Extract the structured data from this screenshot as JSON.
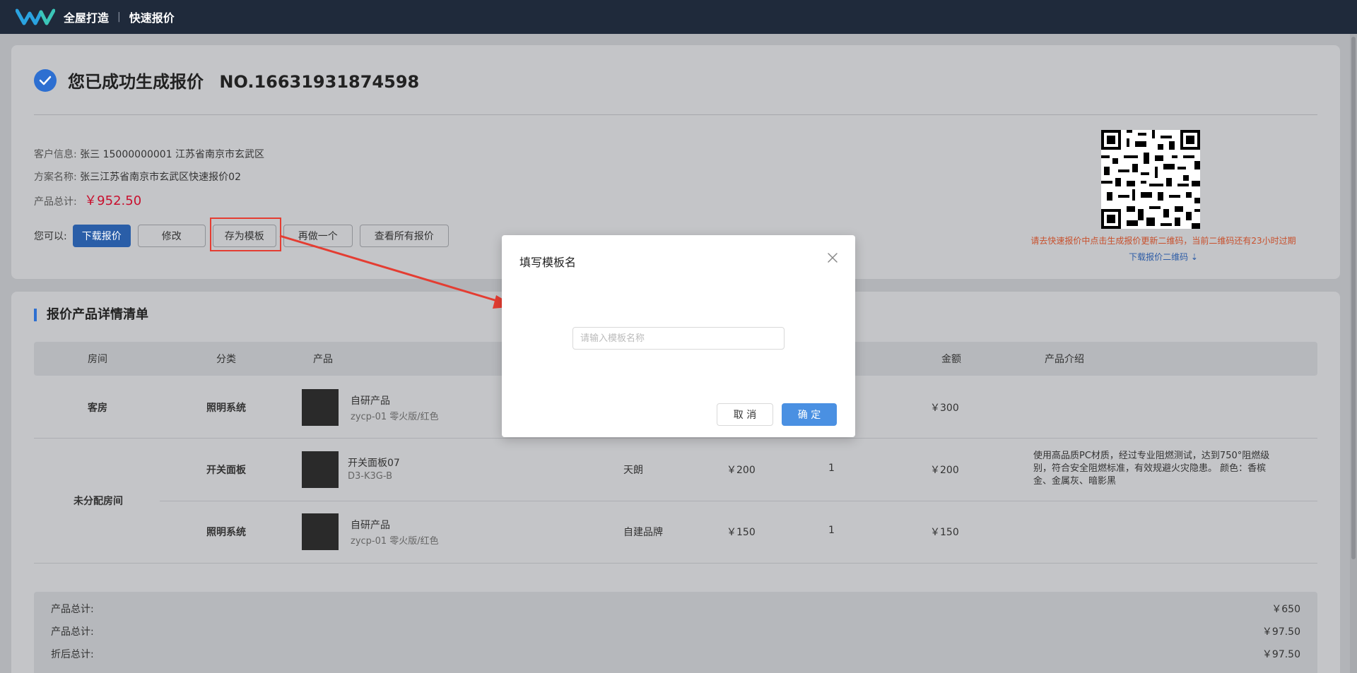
{
  "topbar": {
    "app_name": "全屋打造",
    "separator": "|",
    "page_name": "快速报价"
  },
  "success": {
    "message": "您已成功生成报价",
    "quote_no": "NO.16631931874598"
  },
  "info": {
    "customer_label": "客户信息:",
    "customer_value": "张三  15000000001  江苏省南京市玄武区",
    "plan_label": "方案名称:",
    "plan_value": "张三江苏省南京市玄武区快速报价02",
    "total_label": "产品总计:",
    "total_value": "￥952.50"
  },
  "actions": {
    "label": "您可以:",
    "download": "下载报价",
    "edit": "修改",
    "save_template": "存为模板",
    "redo": "再做一个",
    "view_all": "查看所有报价"
  },
  "qr": {
    "note": "请去快速报价中点击生成报价更新二维码，当前二维码还有23小时过期",
    "download_link": "下载报价二维码 ⇣"
  },
  "detail": {
    "title": "报价产品详情清单",
    "headers": [
      "房间",
      "分类",
      "产品",
      "金额",
      "产品介绍"
    ],
    "rows": [
      {
        "room": "客房",
        "category": "照明系统",
        "product_name": "自研产品",
        "product_sub": "zycp-01 零火版/红色",
        "brand": "",
        "price": "",
        "qty": "",
        "amount": "￥300",
        "intro": ""
      },
      {
        "room": "未分配房间",
        "category": "开关面板",
        "product_name": "开关面板07",
        "product_sub": "D3-K3G-B",
        "brand": "天朗",
        "price": "￥200",
        "qty": "1",
        "amount": "￥200",
        "intro": "使用高品质PC材质，经过专业阻燃测试，达到750°阻燃级别，符合安全阻燃标准，有效规避火灾隐患。 颜色：香槟金、金属灰、暗影黑"
      },
      {
        "room": "",
        "category": "照明系统",
        "product_name": "自研产品",
        "product_sub": "zycp-01 零火版/红色",
        "brand": "自建品牌",
        "price": "￥150",
        "qty": "1",
        "amount": "￥150",
        "intro": ""
      }
    ]
  },
  "summary": {
    "rows": [
      {
        "label": "产品总计:",
        "value": "￥650"
      },
      {
        "label": "产品总计:",
        "value": "￥97.50"
      },
      {
        "label": "折后总计:",
        "value": "￥97.50"
      }
    ]
  },
  "dialog": {
    "title": "填写模板名",
    "input_placeholder": "请输入模板名称",
    "input_value": "",
    "cancel": "取 消",
    "ok": "确 定"
  },
  "colors": {
    "accent": "#2d6fd1",
    "price_red": "#c8102e",
    "annotation_red": "#e43d32",
    "topbar": "#1f2a3b"
  }
}
